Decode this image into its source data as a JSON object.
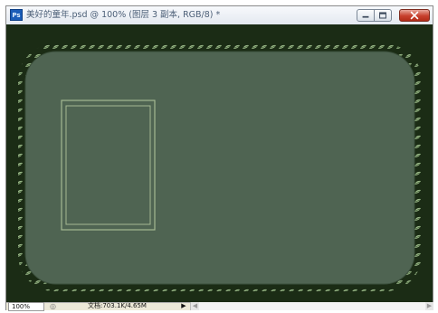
{
  "window": {
    "title": "美好的童年.psd @ 100% (图层 3 副本, RGB/8) *",
    "app_icon_label": "Ps",
    "buttons": {
      "minimize_icon": "minimize-icon",
      "maximize_icon": "maximize-icon",
      "close_icon": "close-icon"
    }
  },
  "canvas": {
    "background_color": "#1b2c15",
    "panel_fill": "#4f6452",
    "border_color": "#8fae7e",
    "frame_color": "#9fb58e"
  },
  "statusbar": {
    "zoom": "100%",
    "doc_info": "文档:703.1K/4.65M",
    "info_icon": "status-icon",
    "menu_arrow": "▶",
    "scroll_left": "◀",
    "scroll_right": "▶"
  }
}
